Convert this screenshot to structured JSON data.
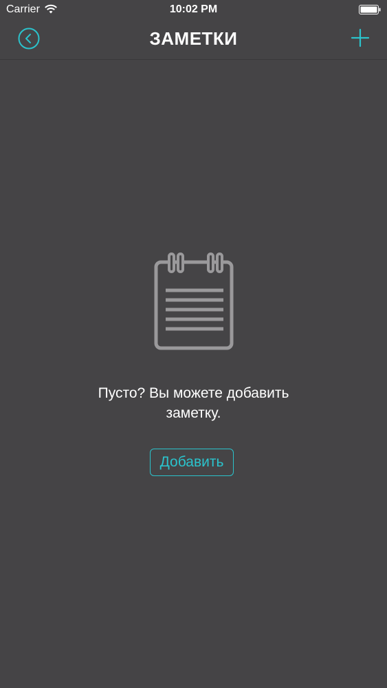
{
  "status_bar": {
    "carrier": "Carrier",
    "time": "10:02 PM",
    "wifi_icon": "wifi-icon",
    "battery_icon": "battery-icon"
  },
  "nav": {
    "title": "ЗАМЕТКИ",
    "back_icon": "back-circle-icon",
    "add_icon": "plus-icon"
  },
  "empty_state": {
    "icon": "notepad-icon",
    "message_line1": "Пусто? Вы можете добавить",
    "message_line2": "заметку.",
    "button_label": "Добавить"
  },
  "colors": {
    "background": "#454446",
    "accent": "#2bc3cc",
    "icon_gray": "#9a999b",
    "text": "#ffffff"
  }
}
